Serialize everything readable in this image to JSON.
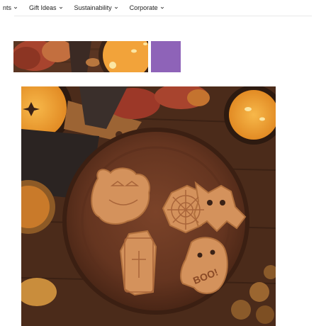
{
  "nav": {
    "items": [
      {
        "label": "nts"
      },
      {
        "label": "Gift Ideas"
      },
      {
        "label": "Sustainability"
      },
      {
        "label": "Corporate"
      }
    ]
  },
  "gallery": {
    "swatch_color": "#8E63B8",
    "main_image_icon": "halloween-cookies-plate-icon",
    "cookie_text": "BOO!"
  },
  "colors": {
    "wood_dark": "#3a2216",
    "wood_mid": "#5a3522",
    "plate": "#6b3b24",
    "cookie": "#d4925c",
    "soup": "#f2a33a"
  }
}
